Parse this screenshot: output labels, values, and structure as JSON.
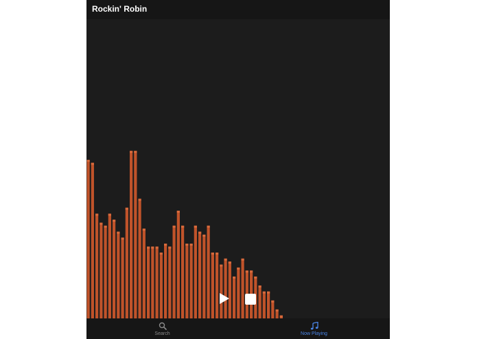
{
  "header": {
    "title": "Rockin' Robin"
  },
  "visualizer": {
    "bar_color": "#c0532a",
    "bar_highlight_color": "#d86a3c",
    "levels": [
      0.53,
      0.52,
      0.35,
      0.32,
      0.31,
      0.35,
      0.33,
      0.29,
      0.27,
      0.37,
      0.56,
      0.56,
      0.4,
      0.3,
      0.24,
      0.24,
      0.24,
      0.22,
      0.25,
      0.24,
      0.31,
      0.36,
      0.31,
      0.25,
      0.25,
      0.31,
      0.29,
      0.28,
      0.31,
      0.22,
      0.22,
      0.18,
      0.2,
      0.19,
      0.14,
      0.17,
      0.2,
      0.16,
      0.16,
      0.14,
      0.11,
      0.09,
      0.09,
      0.06,
      0.03,
      0.01
    ],
    "peak_index": 11
  },
  "controls": {
    "play_icon": "play-icon",
    "stop_icon": "stop-icon"
  },
  "tabbar": {
    "active_color": "#4a86e8",
    "inactive_color": "#8a8a8a",
    "tabs": [
      {
        "label": "Search",
        "icon": "search-icon"
      },
      {
        "label": "Now Playing",
        "icon": "music-note-icon"
      }
    ]
  }
}
